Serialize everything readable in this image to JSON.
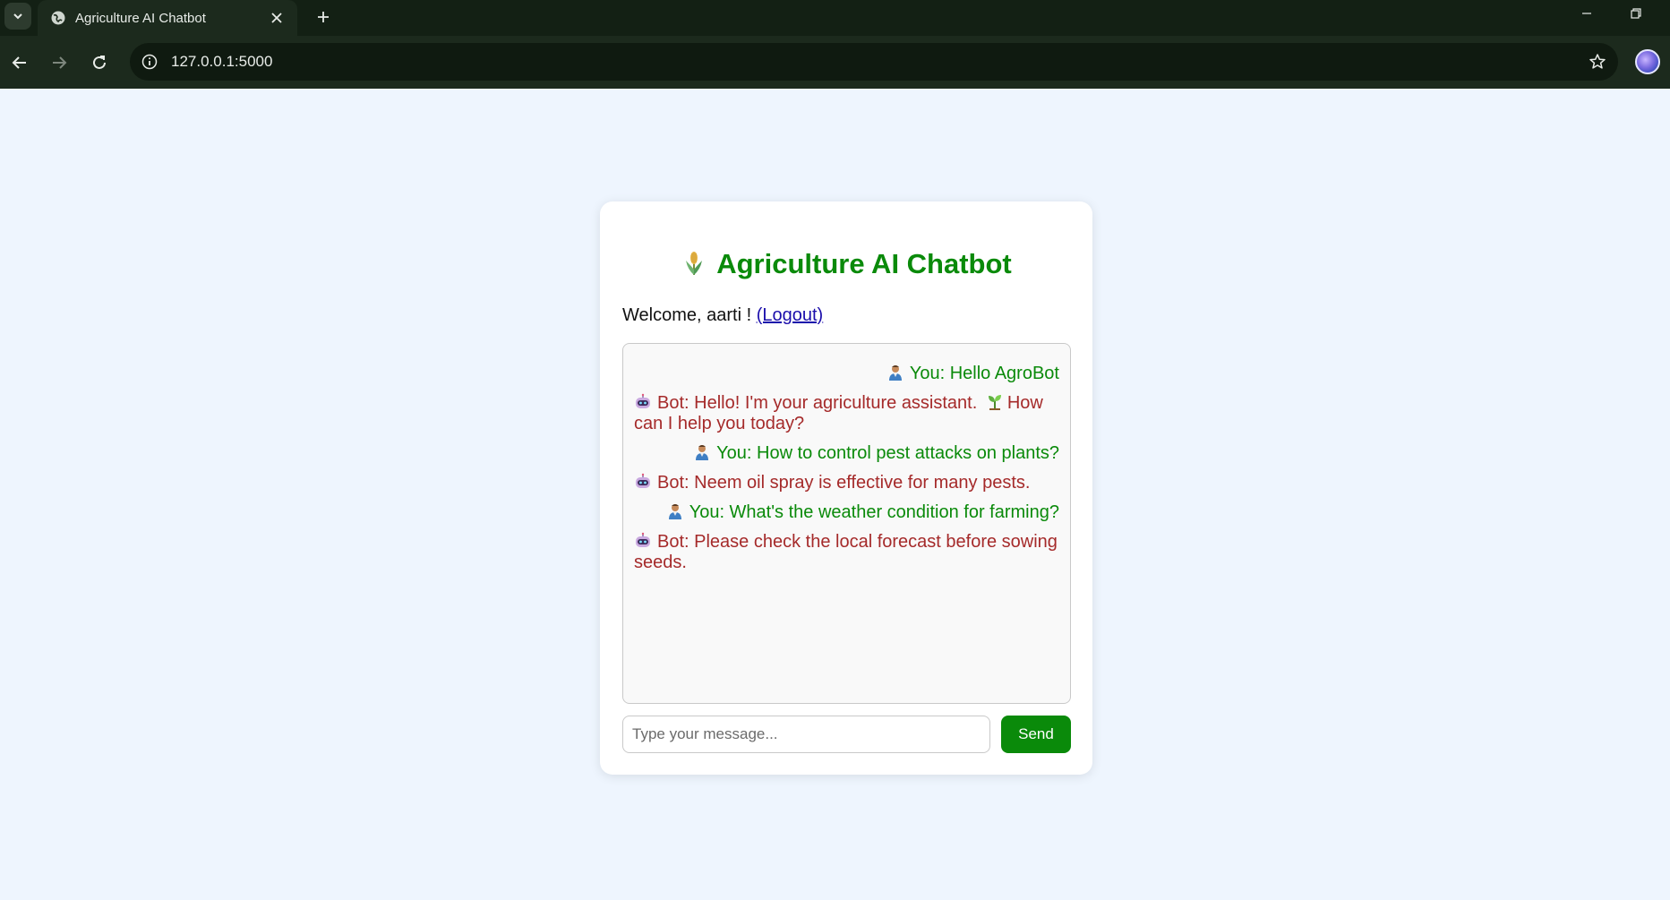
{
  "browser": {
    "tab_title": "Agriculture AI Chatbot",
    "url": "127.0.0.1:5000"
  },
  "page": {
    "title": "Agriculture AI Chatbot",
    "welcome_prefix": "Welcome, aarti !",
    "logout_label": "(Logout)",
    "input_placeholder": "Type your message...",
    "send_label": "Send",
    "messages": [
      {
        "role": "user",
        "icon": "farmer-icon",
        "text": "You: Hello AgroBot"
      },
      {
        "role": "bot",
        "icon": "robot-icon",
        "text_before": "Bot: Hello! I'm your agriculture assistant.",
        "inline_icon": "seedling-icon",
        "text_after": "How can I help you today?"
      },
      {
        "role": "user",
        "icon": "farmer-icon",
        "text": "You: How to control pest attacks on plants?"
      },
      {
        "role": "bot",
        "icon": "robot-icon",
        "text": "Bot: Neem oil spray is effective for many pests."
      },
      {
        "role": "user",
        "icon": "farmer-icon",
        "text": "You: What's the weather condition for farming?"
      },
      {
        "role": "bot",
        "icon": "robot-icon",
        "text": "Bot: Please check the local forecast before sowing seeds."
      }
    ],
    "colors": {
      "title": "#0a8a0a",
      "user_text": "#0a8a0a",
      "bot_text": "#a52a2a",
      "send_button": "#0a8a0a",
      "background": "#eef5fe"
    }
  }
}
